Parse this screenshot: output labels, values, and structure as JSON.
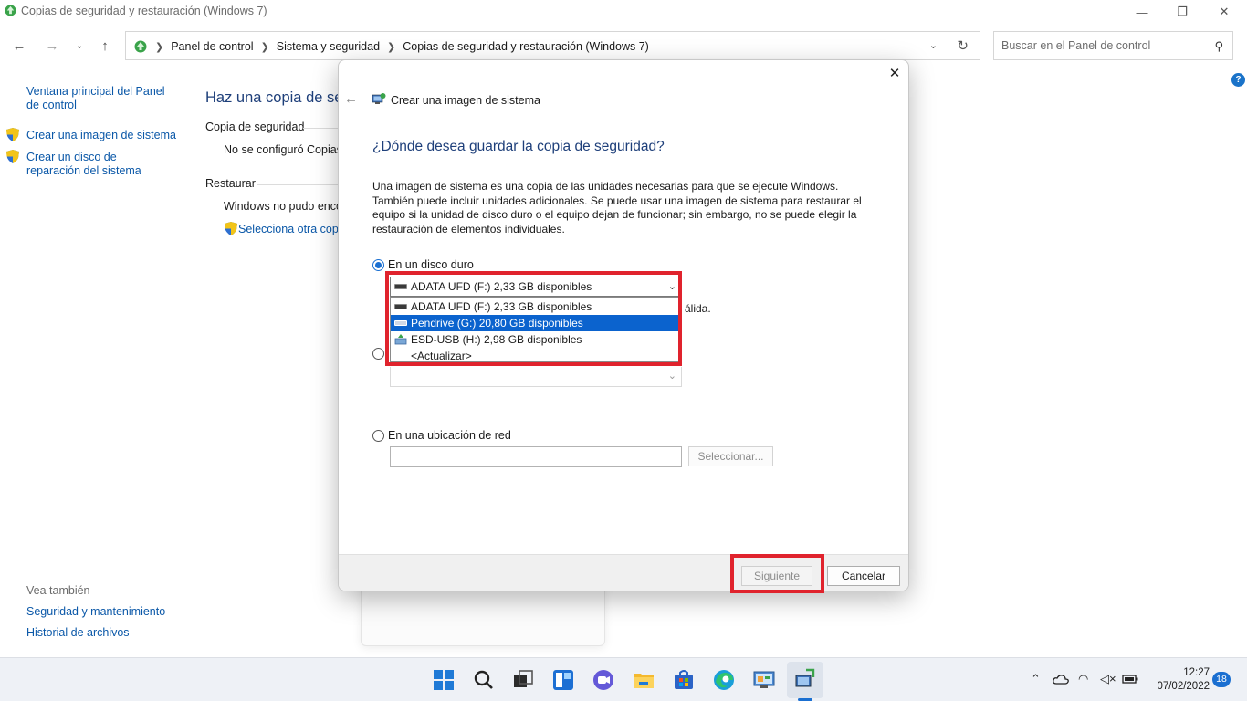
{
  "window": {
    "title": "Copias de seguridad y restauración (Windows 7)",
    "minimize_symbol": "—",
    "restore_symbol": "❐",
    "close_symbol": "✕"
  },
  "address": {
    "breadcrumbs": [
      "Panel de control",
      "Sistema y seguridad",
      "Copias de seguridad y restauración (Windows 7)"
    ],
    "search_placeholder": "Buscar en el Panel de control"
  },
  "help_label": "?",
  "sidebar": {
    "main_link": "Ventana principal del Panel de control",
    "tasks": [
      {
        "label": "Crear una imagen de sistema",
        "icon": "shield-icon"
      },
      {
        "label": "Crear un disco de reparación del sistema",
        "icon": "shield-icon"
      }
    ],
    "see_also_title": "Vea también",
    "see_also": [
      "Seguridad y mantenimiento",
      "Historial de archivos"
    ]
  },
  "main": {
    "title": "Haz una copia de seg",
    "backup_section": "Copia de seguridad",
    "backup_status": "No se configuró Copias",
    "restore_section": "Restaurar",
    "restore_status": "Windows no pudo enco",
    "restore_link": "Selecciona otra copia"
  },
  "dialog": {
    "title": "Crear una imagen de sistema",
    "heading": "¿Dónde desea guardar la copia de seguridad?",
    "description": "Una imagen de sistema es una copia de las unidades necesarias para que se ejecute Windows. También puede incluir unidades adicionales. Se puede usar una imagen de sistema para restaurar el equipo si la unidad de disco duro o el equipo dejan de funcionar; sin embargo, no se puede elegir la restauración de elementos individuales.",
    "option_hdd": "En un disco duro",
    "selected_drive": "ADATA UFD (F:)  2,33 GB disponibles",
    "drive_options": [
      "ADATA UFD (F:)  2,33 GB disponibles",
      "Pendrive (G:)  20,80 GB disponibles",
      "ESD-USB (H:)  2,98 GB disponibles",
      "<Actualizar>"
    ],
    "highlighted_option": "Pendrive (G:)  20,80 GB disponibles",
    "partial_text": "álida.",
    "option_network": "En una ubicación de red",
    "select_button": "Seleccionar...",
    "next_button": "Siguiente",
    "cancel_button": "Cancelar"
  },
  "annotation_color": "#e0232d",
  "taskbar": {
    "apps": [
      "start-icon",
      "search-icon",
      "task-view-icon",
      "widgets-icon",
      "chat-icon",
      "file-explorer-icon",
      "store-icon",
      "edge-icon",
      "control-panel-icon",
      "backup-icon"
    ],
    "time": "12:27",
    "date": "07/02/2022",
    "notification_count": "18"
  }
}
